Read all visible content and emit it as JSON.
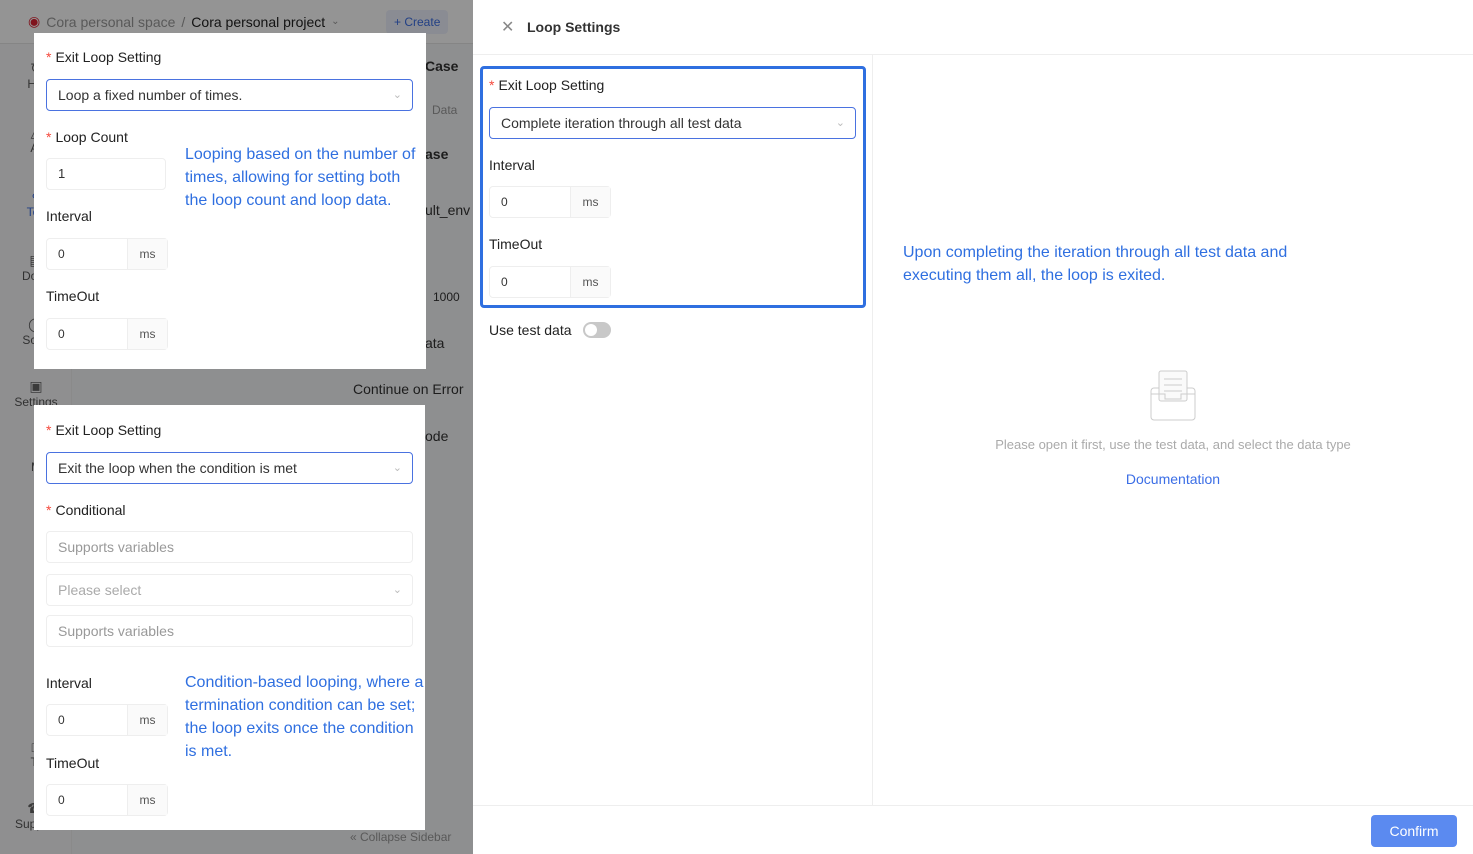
{
  "header": {
    "space": "Cora personal space",
    "separator": "/",
    "project": "Cora personal project",
    "create": "Create"
  },
  "sidebar": {
    "items": [
      {
        "label": "His",
        "icon": "history-icon"
      },
      {
        "label": "AI",
        "icon": "ai-icon"
      },
      {
        "label": "Tes",
        "icon": "test-icon",
        "active": true
      },
      {
        "label": "Docu",
        "icon": "document-icon"
      },
      {
        "label": "Sche",
        "icon": "schedule-icon"
      },
      {
        "label": "Settings",
        "icon": "settings-icon"
      },
      {
        "label": "M",
        "icon": "more-icon"
      },
      {
        "label": "Tr",
        "icon": "trash-icon"
      },
      {
        "label": "Support",
        "icon": "support-icon"
      }
    ],
    "collapse": "Collapse Sidebar"
  },
  "background": {
    "case": "Case",
    "data": "Data",
    "ase": "ase",
    "env": "ult_env",
    "num": "1000",
    "ata": "ata",
    "continue": "Continue on Error",
    "mode": "ode"
  },
  "card1": {
    "exit_label": "Exit Loop Setting",
    "exit_value": "Loop a fixed number of times.",
    "count_label": "Loop Count",
    "count_value": "1",
    "interval_label": "Interval",
    "interval_value": "0",
    "timeout_label": "TimeOut",
    "timeout_value": "0",
    "unit": "ms",
    "note": "Looping based on the number of times, allowing for setting both the loop count and loop data."
  },
  "card2": {
    "exit_label": "Exit Loop Setting",
    "exit_value": "Exit the loop when the condition is met",
    "cond_label": "Conditional",
    "cond_ph1": "Supports variables",
    "cond_select_ph": "Please select",
    "cond_ph2": "Supports variables",
    "interval_label": "Interval",
    "interval_value": "0",
    "timeout_label": "TimeOut",
    "timeout_value": "0",
    "unit": "ms",
    "note": "Condition-based looping, where a termination condition can be set; the loop exits once the condition is met."
  },
  "panel": {
    "title": "Loop Settings",
    "exit_label": "Exit Loop Setting",
    "exit_value": "Complete iteration through all test data",
    "interval_label": "Interval",
    "interval_value": "0",
    "timeout_label": "TimeOut",
    "timeout_value": "0",
    "unit": "ms",
    "use_test_data": "Use test data",
    "use_test_data_on": false,
    "note": "Upon completing the iteration through all test data and executing them all, the loop is exited.",
    "empty_text": "Please open it first, use the test data, and select the data type",
    "doc_link": "Documentation",
    "confirm": "Confirm"
  },
  "colors": {
    "accent": "#2f6fe0",
    "button": "#5b8af0",
    "required": "#f5483b"
  }
}
